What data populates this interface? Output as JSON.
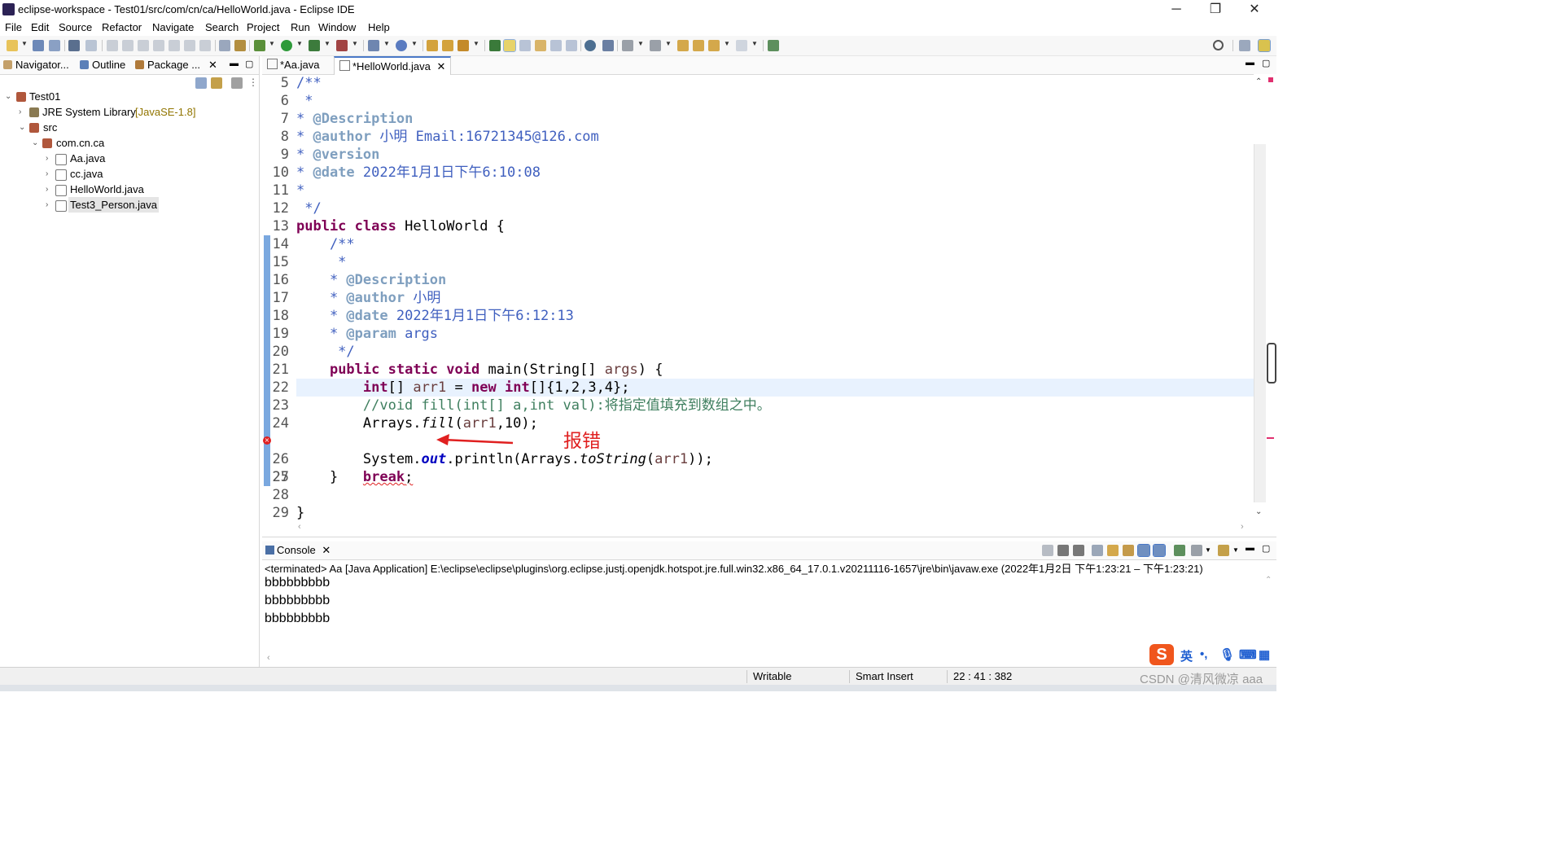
{
  "window": {
    "title": "eclipse-workspace - Test01/src/com/cn/ca/HelloWorld.java - Eclipse IDE",
    "minimize": "─",
    "restore": "❐",
    "close": "✕"
  },
  "menu": [
    "File",
    "Edit",
    "Source",
    "Refactor",
    "Navigate",
    "Search",
    "Project",
    "Run",
    "Window",
    "Help"
  ],
  "left_tabs": {
    "navigator": "Navigator...",
    "outline": "Outline",
    "package": "Package ...",
    "close": "✕"
  },
  "tree": {
    "project": "Test01",
    "jre": "JRE System Library",
    "jre_decor": "[JavaSE-1.8]",
    "src": "src",
    "package": "com.cn.ca",
    "files": [
      "Aa.java",
      "cc.java",
      "HelloWorld.java",
      "Test3_Person.java"
    ]
  },
  "editor_tabs": {
    "tab1": "*Aa.java",
    "tab2": "*HelloWorld.java",
    "close": "✕"
  },
  "line_numbers": [
    "5",
    "6",
    "7",
    "8",
    "9",
    "10",
    "11",
    "12",
    "13",
    "14",
    "15",
    "16",
    "17",
    "18",
    "19",
    "20",
    "21",
    "22",
    "23",
    "24",
    "25",
    "26",
    "27",
    "28",
    "29"
  ],
  "code": {
    "l5": "/**",
    "l6": " *",
    "l7_star": "* ",
    "l7_tag": "@Description",
    "l8_star": "* ",
    "l8_tag": "@author",
    "l8_rest": " 小明 Email:16721345@126.com",
    "l9_star": "* ",
    "l9_tag": "@version",
    "l10_star": "* ",
    "l10_tag": "@date",
    "l10_rest": " 2022年1月1日下午6:10:08",
    "l11": "*",
    "l12": " */",
    "l13_kw1": "public",
    "l13_kw2": "class",
    "l13_rest": " HelloWorld {",
    "l14": "    /**",
    "l15": "     *",
    "l16_star": "    * ",
    "l16_tag": "@Description",
    "l17_star": "    * ",
    "l17_tag": "@author",
    "l17_rest": " 小明",
    "l18_star": "    * ",
    "l18_tag": "@date",
    "l18_rest": " 2022年1月1日下午6:12:13",
    "l19_star": "    * ",
    "l19_tag": "@param",
    "l19_rest": " args",
    "l20": "     */",
    "l21_indent": "    ",
    "l21_kw1": "public",
    "l21_kw2": "static",
    "l21_kw3": "void",
    "l21_rest": " main(String[] ",
    "l21_var": "args",
    "l21_end": ") {",
    "l22_indent": "        ",
    "l22_kw1": "int",
    "l22_mid": "[] ",
    "l22_var": "arr1",
    "l22_eq": " = ",
    "l22_kw2": "new",
    "l22_kw3": "int",
    "l22_end": "[]{1,2,3,4};",
    "l23": "        //void fill(int[] a,int val):将指定值填充到数组之中。",
    "l24_a": "        Arrays.",
    "l24_method": "fill",
    "l24_b": "(",
    "l24_var": "arr1",
    "l24_end": ",10);",
    "l25_indent": "        ",
    "l25_kw": "break",
    "l25_end": ";",
    "l26_a": "        System.",
    "l26_field": "out",
    "l26_b": ".println(Arrays.",
    "l26_method": "toString",
    "l26_c": "(",
    "l26_var": "arr1",
    "l26_end": "));",
    "l27": "    }",
    "l28": "",
    "l29": "}"
  },
  "annotation": "报错",
  "console": {
    "tab": "Console",
    "close": "✕",
    "header": "<terminated> Aa [Java Application] E:\\eclipse\\eclipse\\plugins\\org.eclipse.justj.openjdk.hotspot.jre.full.win32.x86_64_17.0.1.v20211116-1657\\jre\\bin\\javaw.exe  (2022年1月2日 下午1:23:21 – 下午1:23:21)",
    "lines": [
      "bbbbbbbbb",
      "bbbbbbbbb",
      "bbbbbbbbb"
    ]
  },
  "status": {
    "writable": "Writable",
    "insert": "Smart Insert",
    "position": "22 : 41 : 382"
  },
  "ime": {
    "logo": "S",
    "lang": "英"
  },
  "watermark": "CSDN @清风微凉 aaa",
  "colors": {
    "keyword": "#7f0055",
    "javadoc": "#3f5fbf",
    "comment": "#3f7f5f",
    "error": "#e02020",
    "accent": "#4a79c7"
  }
}
